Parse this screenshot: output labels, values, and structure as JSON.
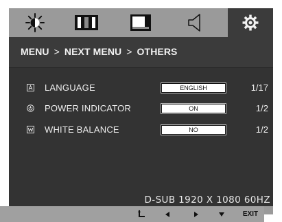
{
  "tabs": [
    {
      "icon": "brightness-sun-icon",
      "active": false
    },
    {
      "icon": "picture-columns-icon",
      "active": false
    },
    {
      "icon": "screen-window-icon",
      "active": false
    },
    {
      "icon": "speaker-volume-icon",
      "active": false
    },
    {
      "icon": "settings-gear-icon",
      "active": true
    }
  ],
  "breadcrumb": {
    "menu": "MENU",
    "sep1": ">",
    "next_menu": "NEXT MENU",
    "sep2": ">",
    "current": "OTHERS"
  },
  "settings": [
    {
      "icon": "language-icon",
      "label": "LANGUAGE",
      "value": "ENGLISH",
      "page": "1/17"
    },
    {
      "icon": "power-indicator-icon",
      "label": "POWER INDICATOR",
      "value": "ON",
      "page": "1/2"
    },
    {
      "icon": "white-balance-icon",
      "label": "WHITE BALANCE",
      "value": "NO",
      "page": "1/2"
    }
  ],
  "status": "D-SUB 1920 X 1080 60HZ",
  "footer": {
    "back_icon": "back-return-icon",
    "left_icon": "left-arrow-icon",
    "right_icon": "right-arrow-icon",
    "down_icon": "down-arrow-icon",
    "exit_label": "EXIT"
  },
  "colors": {
    "panel": "#333333",
    "tab_bar": "#9a9a9a",
    "active_tab": "#3b3b3b",
    "text": "#f2f2f2"
  }
}
